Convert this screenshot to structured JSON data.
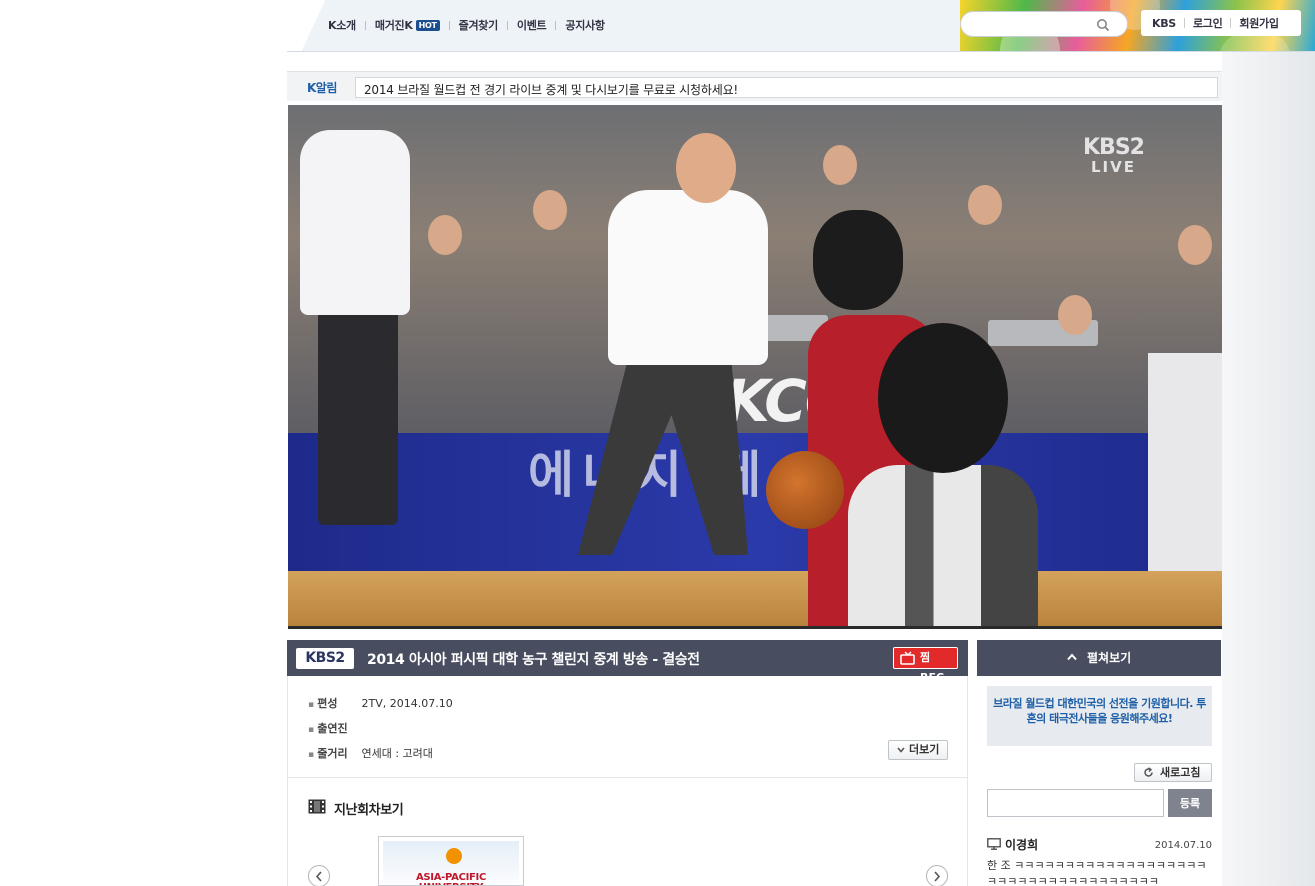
{
  "nav": {
    "items": [
      {
        "label": "K소개"
      },
      {
        "label": "매거진K",
        "badge": "HOT"
      },
      {
        "label": "즐겨찾기"
      },
      {
        "label": "이벤트"
      },
      {
        "label": "공지사항"
      }
    ]
  },
  "search": {
    "placeholder": ""
  },
  "util": {
    "kbs": "KBS",
    "login": "로그인",
    "signup": "회원가입"
  },
  "notice": {
    "label": "K알림",
    "text": "2014 브라질 월드컵 전 경기 라이브 중계 및 다시보기를 무료로 시청하세요!"
  },
  "video": {
    "channel_logo": "KBS2",
    "live_label": "LIVE",
    "board_logo": "KCC"
  },
  "program": {
    "channel": "KBS2",
    "title": "2014 아시아 퍼시픽 대학 농구 챌린지 중계 방송 - 결승전",
    "rec_label": "찜 REC",
    "info": [
      {
        "key": "편성",
        "value": "2TV, 2014.07.10"
      },
      {
        "key": "출연진",
        "value": ""
      },
      {
        "key": "줄거리",
        "value": "연세대 : 고려대"
      }
    ],
    "more_label": "더보기",
    "past_title": "지난회차보기",
    "thumb_text": "ASIA-PACIFIC UNIVERSITY"
  },
  "side": {
    "toggle_label": "펼쳐보기",
    "notice": "브라질 월드컵 대한민국의 선전을 기원합니다. 투혼의 태극전사들을 응원해주세요!",
    "refresh_label": "새로고침",
    "comment_placeholder": "",
    "submit_label": "등록",
    "comments": [
      {
        "user": "이경희",
        "date": "2014.07.10",
        "text": "한 조 ㅋㅋㅋㅋㅋㅋㅋㅋㅋㅋㅋㅋㅋㅋㅋㅋㅋㅋㅋㅋㅋㅋㅋㅋㅋㅋㅋㅋㅋㅋㅋㅋㅋㅋㅋㅋ"
      }
    ]
  },
  "colors": {
    "header_bar": "#484d5f",
    "accent_blue": "#1d5fa8",
    "rec_red": "#e22a2a"
  }
}
